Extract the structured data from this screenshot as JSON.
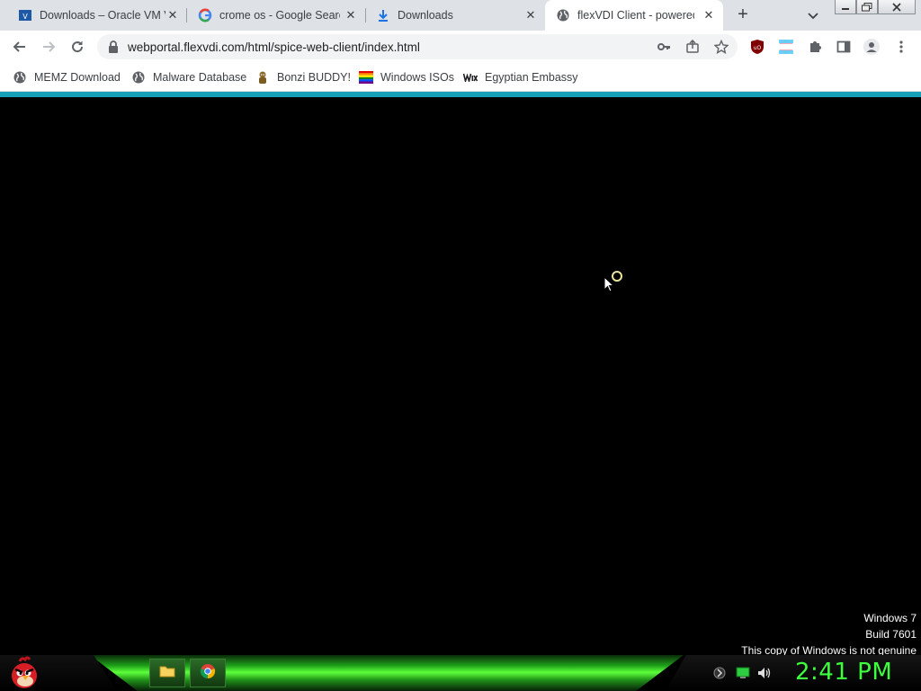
{
  "tabs": [
    {
      "title": "Downloads – Oracle VM V",
      "icon": "virtualbox-icon",
      "active": false
    },
    {
      "title": "crome os - Google Search",
      "icon": "google-icon",
      "active": false
    },
    {
      "title": "Downloads",
      "icon": "download-icon",
      "active": false
    },
    {
      "title": "flexVDI Client - powered",
      "icon": "globe-icon",
      "active": true
    }
  ],
  "tab_close_glyph": "✕",
  "new_tab_glyph": "+",
  "address_bar": {
    "url": "webportal.flexvdi.com/html/spice-web-client/index.html"
  },
  "bookmarks": [
    {
      "label": "MEMZ Download",
      "icon": "globe-icon"
    },
    {
      "label": "Malware Database",
      "icon": "globe-icon"
    },
    {
      "label": "Bonzi BUDDY!",
      "icon": "bonzi-icon"
    },
    {
      "label": "Windows ISOs",
      "icon": "rainbow-flag-icon"
    },
    {
      "label": "Egyptian Embassy",
      "icon": "wix-icon"
    }
  ],
  "watermark": {
    "line1": "Windows 7",
    "line2": "Build 7601",
    "line3": "This copy of Windows is not genuine"
  },
  "taskbar": {
    "clock": "2:41 PM",
    "apps": [
      "folder-icon",
      "chrome-icon"
    ]
  },
  "colors": {
    "accent_strip": "#16a0b8",
    "clock": "#3dff3d",
    "taskbar_glow": "#5cff3a"
  }
}
